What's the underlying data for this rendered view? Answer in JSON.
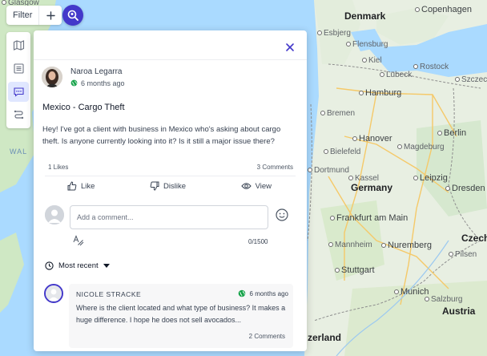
{
  "map": {
    "countries": {
      "denmark": "Denmark",
      "germany": "Germany",
      "austria": "Austria",
      "czech": "Czech"
    },
    "sea": "WAL",
    "cities": {
      "glasgow": "Glasgow",
      "copenhagen": "Copenhagen",
      "esbjerg": "Esbjerg",
      "flensburg": "Flensburg",
      "kiel": "Kiel",
      "rostock": "Rostock",
      "lubeck": "Lübeck",
      "hamburg": "Hamburg",
      "szczecin": "Szczecin",
      "bremen": "Bremen",
      "berlin": "Berlin",
      "hanover": "Hanover",
      "bielefeld": "Bielefeld",
      "magdeburg": "Magdeburg",
      "dortmund": "Dortmund",
      "kassel": "Kassel",
      "leipzig": "Leipzig",
      "dresden": "Dresden",
      "frankfurt": "Frankfurt am Main",
      "mannheim": "Mannheim",
      "nuremberg": "Nuremberg",
      "stuttgart": "Stuttgart",
      "munich": "Munich",
      "salzburg": "Salzburg",
      "pilsen": "Pilsen",
      "switzerland": "zerland"
    }
  },
  "toolbar": {
    "filter_label": "Filter",
    "plus_icon": "plus-icon",
    "search_icon": "search-location-icon"
  },
  "rail": {
    "items": [
      "map-icon",
      "list-icon",
      "chat-icon",
      "route-icon"
    ]
  },
  "post": {
    "author": "Naroa Legarra",
    "time": "6 months ago",
    "visibility_icon": "globe-icon",
    "title": "Mexico - Cargo Theft",
    "body": "Hey! I've got a client with business in Mexico who's asking about cargo theft. Is anyone currently looking into it? Is it still a major issue there?",
    "likes": "1 Likes",
    "comments": "3 Comments",
    "actions": {
      "like": "Like",
      "dislike": "Dislike",
      "view": "View"
    }
  },
  "comment_box": {
    "placeholder": "Add a comment...",
    "counter": "0/1500"
  },
  "sort": {
    "label": "Most recent"
  },
  "reply": {
    "author": "NICOLE STRACKE",
    "time": "6 months ago",
    "body": "Where is the client located and what type of business? It makes a huge difference. I hope he does not sell avocados...",
    "comments": "2 Comments"
  },
  "colors": {
    "accent": "#4338ca",
    "globe": "#16a34a",
    "map_land": "#e8f0e4",
    "map_water": "#aadaff"
  }
}
